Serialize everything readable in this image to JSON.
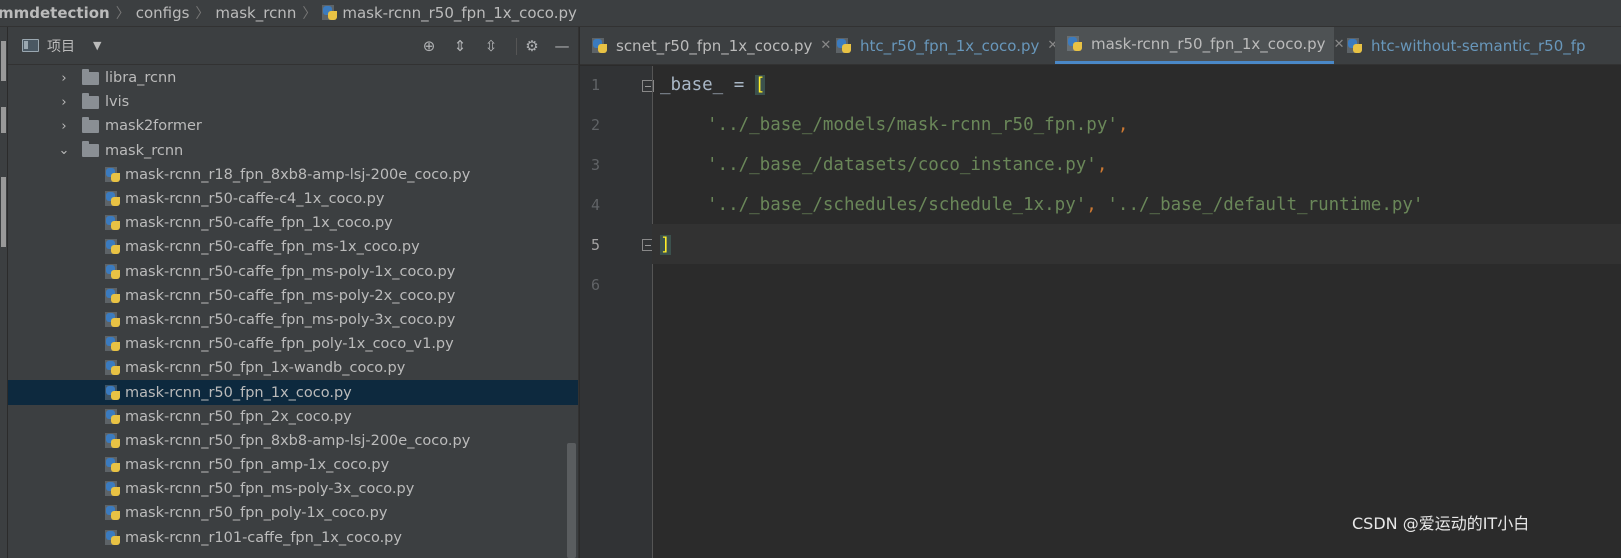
{
  "breadcrumb": [
    "mmdetection",
    "configs",
    "mask_rcnn",
    "mask-rcnn_r50_fpn_1x_coco.py"
  ],
  "project_panel": {
    "title": "项目",
    "tools": [
      "locate-icon",
      "expand-all-icon",
      "collapse-all-icon",
      "gear-icon",
      "minimize-icon"
    ]
  },
  "tree": {
    "folders": [
      {
        "label": "libra_rcnn",
        "expanded": false
      },
      {
        "label": "lvis",
        "expanded": false
      },
      {
        "label": "mask2former",
        "expanded": false
      },
      {
        "label": "mask_rcnn",
        "expanded": true
      }
    ],
    "files": [
      "mask-rcnn_r18_fpn_8xb8-amp-lsj-200e_coco.py",
      "mask-rcnn_r50-caffe-c4_1x_coco.py",
      "mask-rcnn_r50-caffe_fpn_1x_coco.py",
      "mask-rcnn_r50-caffe_fpn_ms-1x_coco.py",
      "mask-rcnn_r50-caffe_fpn_ms-poly-1x_coco.py",
      "mask-rcnn_r50-caffe_fpn_ms-poly-2x_coco.py",
      "mask-rcnn_r50-caffe_fpn_ms-poly-3x_coco.py",
      "mask-rcnn_r50-caffe_fpn_poly-1x_coco_v1.py",
      "mask-rcnn_r50_fpn_1x-wandb_coco.py",
      "mask-rcnn_r50_fpn_1x_coco.py",
      "mask-rcnn_r50_fpn_2x_coco.py",
      "mask-rcnn_r50_fpn_8xb8-amp-lsj-200e_coco.py",
      "mask-rcnn_r50_fpn_amp-1x_coco.py",
      "mask-rcnn_r50_fpn_ms-poly-3x_coco.py",
      "mask-rcnn_r50_fpn_poly-1x_coco.py",
      "mask-rcnn_r101-caffe_fpn_1x_coco.py"
    ],
    "selected_file": "mask-rcnn_r50_fpn_1x_coco.py"
  },
  "tabs": [
    {
      "label": "scnet_r50_fpn_1x_coco.py",
      "active": false,
      "color": "#bbbbbb"
    },
    {
      "label": "htc_r50_fpn_1x_coco.py",
      "active": false,
      "color": "#6897bb"
    },
    {
      "label": "mask-rcnn_r50_fpn_1x_coco.py",
      "active": true,
      "color": "#bbbbbb"
    },
    {
      "label": "htc-without-semantic_r50_fp",
      "active": false,
      "color": "#6897bb"
    }
  ],
  "editor": {
    "line_numbers": [
      "1",
      "2",
      "3",
      "4",
      "5",
      "6"
    ],
    "current_line": "5",
    "code": {
      "l1_name": "_base_",
      "l1_eq": " = ",
      "l1_open": "[",
      "l2_str": "'../_base_/models/mask-rcnn_r50_fpn.py'",
      "l3_str": "'../_base_/datasets/coco_instance.py'",
      "l4_str1": "'../_base_/schedules/schedule_1x.py'",
      "l4_str2": "'../_base_/default_runtime.py'",
      "comma": ",",
      "l5_close": "]"
    }
  },
  "watermark": "CSDN @爱运动的IT小白",
  "colors": {
    "string": "#6a8759",
    "punctuation": "#cc7832",
    "bracket_match": "#ffef28",
    "selection": "#0d293e",
    "active_tab_underline": "#4a88c7"
  }
}
